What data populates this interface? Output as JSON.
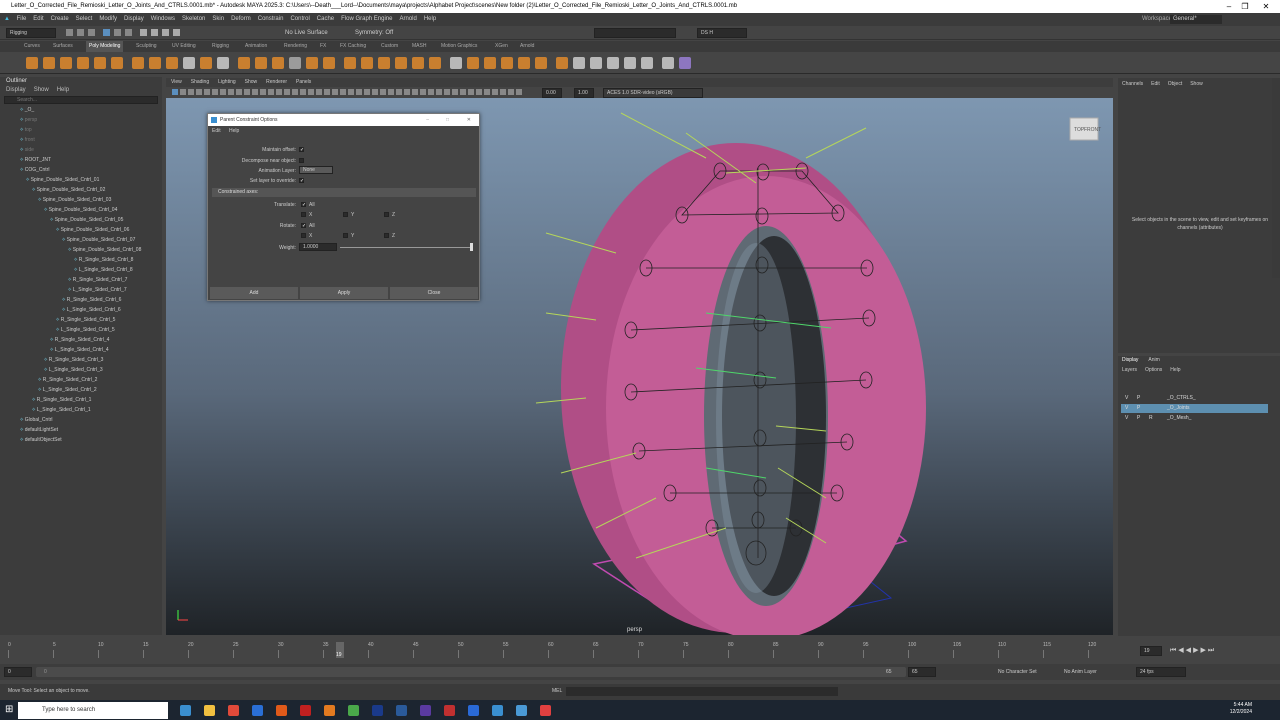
{
  "window": {
    "title": "Letter_O_Corrected_File_Remioski_Letter_O_Joints_And_CTRLS.0001.mb* - Autodesk MAYA 2025.3: C:\\Users\\--Death___Lord--\\Documents\\maya\\projects\\Alphabet Project\\scenes\\New folder (2)\\Letter_O_Corrected_File_Remioski_Letter_O_Joints_And_CTRLS.0001.mb",
    "minimize": "–",
    "maximize": "❐",
    "close": "✕"
  },
  "menubar": [
    "File",
    "Edit",
    "Create",
    "Select",
    "Modify",
    "Display",
    "Windows",
    "Skeleton",
    "Skin",
    "Deform",
    "Constrain",
    "Control",
    "Cache",
    "Flow Graph Engine",
    "Arnold",
    "Help"
  ],
  "workspace": {
    "label": "Workspace:",
    "value": "General*"
  },
  "statusline": {
    "menuset": "Rigging",
    "live_surface": "No Live Surface",
    "symmetry": "Symmetry: Off",
    "camera": "DS H"
  },
  "shelf_tabs": [
    "Curves",
    "Surfaces",
    "Poly Modeling",
    "Sculpting",
    "UV Editing",
    "Rigging",
    "Animation",
    "Rendering",
    "FX",
    "FX Caching",
    "Custom",
    "MASH",
    "Motion Graphics",
    "XGen",
    "Arnold"
  ],
  "shelf_active": "Poly Modeling",
  "outliner": {
    "title": "Outliner",
    "menu": [
      "Display",
      "Show",
      "Help"
    ],
    "search_placeholder": "Search...",
    "items": [
      {
        "label": "_O_",
        "depth": 1,
        "dim": false
      },
      {
        "label": "persp",
        "depth": 1,
        "dim": true
      },
      {
        "label": "top",
        "depth": 1,
        "dim": true
      },
      {
        "label": "front",
        "depth": 1,
        "dim": true
      },
      {
        "label": "side",
        "depth": 1,
        "dim": true
      },
      {
        "label": "ROOT_JNT",
        "depth": 1,
        "dim": false
      },
      {
        "label": "COG_Cntrl",
        "depth": 1,
        "dim": false
      },
      {
        "label": "Spine_Double_Sided_Cntrl_01",
        "depth": 2,
        "dim": false
      },
      {
        "label": "Spine_Double_Sided_Cntrl_02",
        "depth": 3,
        "dim": false
      },
      {
        "label": "Spine_Double_Sided_Cntrl_03",
        "depth": 4,
        "dim": false
      },
      {
        "label": "Spine_Double_Sided_Cntrl_04",
        "depth": 5,
        "dim": false
      },
      {
        "label": "Spine_Double_Sided_Cntrl_05",
        "depth": 6,
        "dim": false
      },
      {
        "label": "Spine_Double_Sided_Cntrl_06",
        "depth": 7,
        "dim": false
      },
      {
        "label": "Spine_Double_Sided_Cntrl_07",
        "depth": 8,
        "dim": false
      },
      {
        "label": "Spine_Double_Sided_Cntrl_08",
        "depth": 9,
        "dim": false
      },
      {
        "label": "R_Single_Sided_Cntrl_8",
        "depth": 10,
        "dim": false
      },
      {
        "label": "L_Single_Sided_Cntrl_8",
        "depth": 10,
        "dim": false
      },
      {
        "label": "R_Single_Sided_Cntrl_7",
        "depth": 9,
        "dim": false
      },
      {
        "label": "L_Single_Sided_Cntrl_7",
        "depth": 9,
        "dim": false
      },
      {
        "label": "R_Single_Sided_Cntrl_6",
        "depth": 8,
        "dim": false
      },
      {
        "label": "L_Single_Sided_Cntrl_6",
        "depth": 8,
        "dim": false
      },
      {
        "label": "R_Single_Sided_Cntrl_5",
        "depth": 7,
        "dim": false
      },
      {
        "label": "L_Single_Sided_Cntrl_5",
        "depth": 7,
        "dim": false
      },
      {
        "label": "R_Single_Sided_Cntrl_4",
        "depth": 6,
        "dim": false
      },
      {
        "label": "L_Single_Sided_Cntrl_4",
        "depth": 6,
        "dim": false
      },
      {
        "label": "R_Single_Sided_Cntrl_3",
        "depth": 5,
        "dim": false
      },
      {
        "label": "L_Single_Sided_Cntrl_3",
        "depth": 5,
        "dim": false
      },
      {
        "label": "R_Single_Sided_Cntrl_2",
        "depth": 4,
        "dim": false
      },
      {
        "label": "L_Single_Sided_Cntrl_2",
        "depth": 4,
        "dim": false
      },
      {
        "label": "R_Single_Sided_Cntrl_1",
        "depth": 3,
        "dim": false
      },
      {
        "label": "L_Single_Sided_Cntrl_1",
        "depth": 3,
        "dim": false
      },
      {
        "label": "Global_Cntrl",
        "depth": 1,
        "dim": false
      },
      {
        "label": "defaultLightSet",
        "depth": 1,
        "dim": false
      },
      {
        "label": "defaultObjectSet",
        "depth": 1,
        "dim": false
      }
    ]
  },
  "viewport": {
    "menu": [
      "View",
      "Shading",
      "Lighting",
      "Show",
      "Renderer",
      "Panels"
    ],
    "field_a": "0.00",
    "field_b": "1.00",
    "colorspace": "ACES 1.0 SDR-video (sRGB)",
    "camera_label": "persp",
    "cube_top": "TOP",
    "cube_front": "FRONT"
  },
  "dialog": {
    "title": "Parent Constraint Options",
    "menu": [
      "Edit",
      "Help"
    ],
    "maintain_offset": "Maintain offset:",
    "decompose": "Decompose near object:",
    "anim_layer": "Animation Layer:",
    "anim_layer_value": "None",
    "set_layer": "Set layer to override:",
    "constrained_axes": "Constrained axes:",
    "translate": "Translate:",
    "rotate": "Rotate:",
    "all": "All",
    "x": "X",
    "y": "Y",
    "z": "Z",
    "weight": "Weight:",
    "weight_value": "1.0000",
    "add": "Add",
    "apply": "Apply",
    "close": "Close"
  },
  "channel_box": {
    "menu": [
      "Channels",
      "Edit",
      "Object",
      "Show"
    ],
    "message": "Select objects in the scene to view, edit and set keyframes on channels (attributes)"
  },
  "layer_editor": {
    "tabs": [
      "Display",
      "Anim"
    ],
    "menu": [
      "Layers",
      "Options",
      "Help"
    ],
    "layers": [
      {
        "v": "V",
        "p": "P",
        "r": "",
        "name": "_O_CTRLS_",
        "selected": false
      },
      {
        "v": "V",
        "p": "P",
        "r": "",
        "name": "_O_Joints",
        "selected": true
      },
      {
        "v": "V",
        "p": "P",
        "r": "R",
        "name": "_O_Mesh_",
        "selected": false
      }
    ]
  },
  "timeline": {
    "ticks": [
      "0",
      "5",
      "10",
      "15",
      "20",
      "25",
      "30",
      "35",
      "40",
      "45",
      "50",
      "55",
      "60",
      "65",
      "70",
      "75",
      "80",
      "85",
      "90",
      "95",
      "100",
      "105",
      "110",
      "115",
      "120"
    ],
    "current_frame": "19",
    "current_field": "19"
  },
  "range": {
    "start": "0",
    "start2": "0",
    "end": "65",
    "end2": "65",
    "character_set": "No Character Set",
    "anim_layer": "No Anim Layer",
    "fps": "24 fps"
  },
  "help_line": "Move Tool: Select an object to move.",
  "mel_label": "MEL",
  "taskbar": {
    "search_placeholder": "Type here to search",
    "time": "5:44 AM",
    "date": "12/2/2024"
  }
}
